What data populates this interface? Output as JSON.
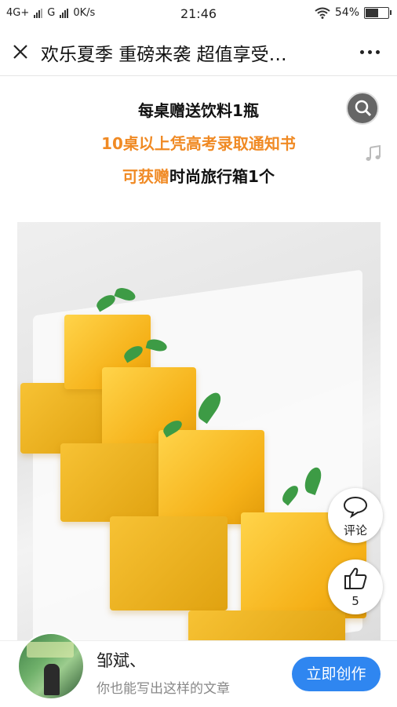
{
  "status_bar": {
    "network": "4G+",
    "carrier2": "G",
    "speed": "0K/s",
    "time": "21:46",
    "battery": "54%",
    "battery_level": 0.54
  },
  "nav": {
    "title": "欢乐夏季 重磅来袭 超值享受…"
  },
  "article": {
    "line1": "每桌赠送饮料1瓶",
    "line2": "10桌以上凭高考录取通知书",
    "line3_orange": "可获赠",
    "line3_rest": "时尚旅行箱1个"
  },
  "actions": {
    "comment_label": "评论",
    "like_count": "5"
  },
  "footer": {
    "author": "邹斌、",
    "tagline": "你也能写出这样的文章",
    "create_button": "立即创作"
  },
  "colors": {
    "accent_orange": "#f08a24",
    "button_blue": "#2f86f0"
  }
}
